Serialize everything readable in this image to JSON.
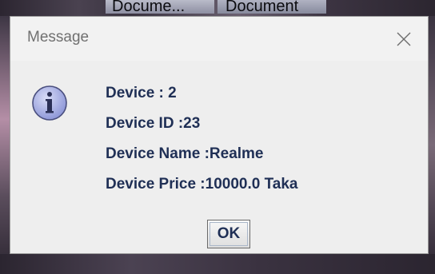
{
  "background": {
    "tabs": [
      "Docume...",
      "Document"
    ]
  },
  "dialog": {
    "title": "Message",
    "icon": "info-icon",
    "lines": [
      "Device : 2",
      "Device ID :23",
      "Device Name :Realme",
      "Device Price :10000.0 Taka"
    ],
    "ok_label": "OK"
  },
  "colors": {
    "dialog_bg": "#eeeeee",
    "text": "#1f2f55",
    "title_text": "#707070",
    "icon_fill": "#aab2e6"
  }
}
